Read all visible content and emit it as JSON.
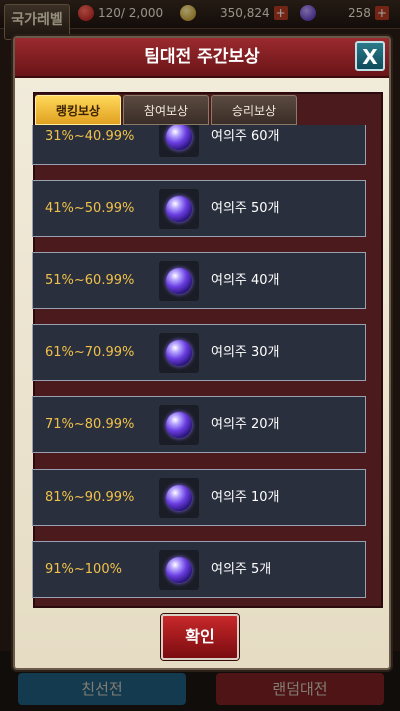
{
  "background": {
    "nation_level_label": "국가레벨",
    "stamina": "120/ 2,000",
    "gold": "350,824",
    "gems": "258",
    "plus_label": "+",
    "bottom_left_button": "친선전",
    "bottom_right_button": "랜덤대전"
  },
  "dialog": {
    "title": "팀대전 주간보상",
    "close_label": "X",
    "tabs": [
      {
        "label": "랭킹보상",
        "active": true
      },
      {
        "label": "참여보상",
        "active": false
      },
      {
        "label": "승리보상",
        "active": false
      }
    ],
    "rows": [
      {
        "range": "31%~40.99%",
        "reward": "여의주 60개"
      },
      {
        "range": "41%~50.99%",
        "reward": "여의주 50개"
      },
      {
        "range": "51%~60.99%",
        "reward": "여의주 40개"
      },
      {
        "range": "61%~70.99%",
        "reward": "여의주 30개"
      },
      {
        "range": "71%~80.99%",
        "reward": "여의주 20개"
      },
      {
        "range": "81%~90.99%",
        "reward": "여의주 10개"
      },
      {
        "range": "91%~100%",
        "reward": "여의주 5개"
      }
    ],
    "confirm_label": "확인"
  },
  "colors": {
    "header": "#8a2228",
    "active_tab": "#f0c030",
    "range_text": "#f0c24a",
    "row_bg": "#2a2f3e"
  }
}
